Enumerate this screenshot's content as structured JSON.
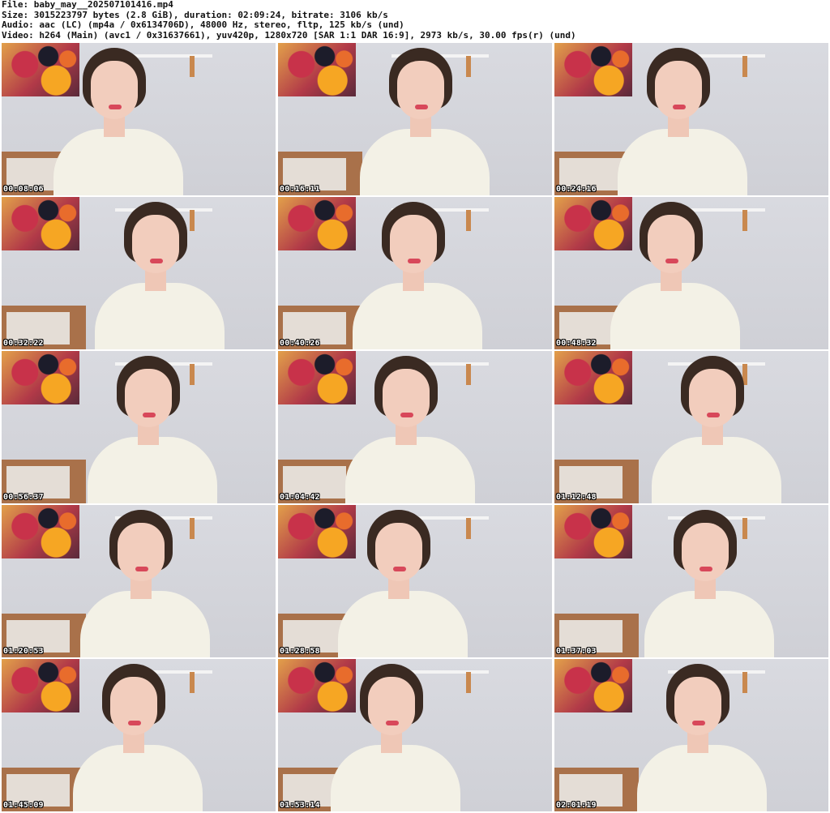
{
  "header": {
    "file": "File: baby_may__202507101416.mp4",
    "size": "Size: 3015223797 bytes (2.8 GiB), duration: 02:09:24, bitrate: 3106 kb/s",
    "audio": "Audio: aac (LC) (mp4a / 0x6134706D), 48000 Hz, stereo, fltp, 125 kb/s (und)",
    "video": "Video: h264 (Main) (avc1 / 0x31637661), yuv420p, 1280x720 [SAR 1:1 DAR 16:9], 2973 kb/s, 30.00 fps(r) (und)"
  },
  "thumbnails": [
    {
      "timestamp": "00:08:06"
    },
    {
      "timestamp": "00:16:11"
    },
    {
      "timestamp": "00:24:16"
    },
    {
      "timestamp": "00:32:22"
    },
    {
      "timestamp": "00:40:26"
    },
    {
      "timestamp": "00:48:32"
    },
    {
      "timestamp": "00:56:37"
    },
    {
      "timestamp": "01:04:42"
    },
    {
      "timestamp": "01:12:48"
    },
    {
      "timestamp": "01:20:53"
    },
    {
      "timestamp": "01:28:58"
    },
    {
      "timestamp": "01:37:03"
    },
    {
      "timestamp": "01:45:09"
    },
    {
      "timestamp": "01:53:14"
    },
    {
      "timestamp": "02:01:19"
    }
  ]
}
